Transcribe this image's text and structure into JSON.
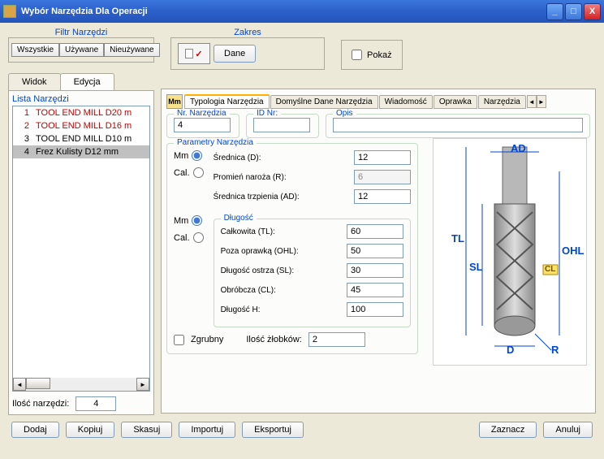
{
  "window": {
    "title": "Wybór Narzędzia Dla Operacji"
  },
  "filter": {
    "label": "Filtr Narzędzi",
    "all": "Wszystkie",
    "used": "Używane",
    "unused": "Nieużywane"
  },
  "zakres": {
    "label": "Zakres",
    "dane": "Dane",
    "pokaz": "Pokaż"
  },
  "tabs": {
    "widok": "Widok",
    "edycja": "Edycja"
  },
  "listLabel": "Lista  Narzędzi",
  "tools": [
    {
      "n": "1",
      "name": "TOOL END MILL  D20 m",
      "red": true
    },
    {
      "n": "2",
      "name": "TOOL END MILL  D16 m",
      "red": true
    },
    {
      "n": "3",
      "name": "TOOL END MILL  D10 m",
      "red": false
    },
    {
      "n": "4",
      "name": "Frez Kulisty  D12 mm",
      "red": false,
      "sel": true
    }
  ],
  "iloscLabel": "Ilość narzędzi:",
  "iloscVal": "4",
  "smallTabs": {
    "typologia": "Typologia Narzędzia",
    "domyslne": "Domyślne Dane Narzędzia",
    "wiadomosc": "Wiadomość",
    "oprawka": "Oprawka",
    "narzedzia": "Narzędzia"
  },
  "fields": {
    "nrLabel": "Nr. Narzędzia",
    "nrVal": "4",
    "idLabel": "ID Nr:",
    "idVal": "",
    "opisLabel": "Opis",
    "opisVal": ""
  },
  "params": {
    "title": "Parametry Narzędzia",
    "mm": "Mm",
    "cal": "Cal.",
    "srednica": "Średnica (D):",
    "srednicaVal": "12",
    "promien": "Promień naroża (R):",
    "promienVal": "6",
    "trzpien": "Średnica trzpienia (AD):",
    "trzpienVal": "12"
  },
  "dlugosc": {
    "title": "Długość",
    "calkowita": "Całkowita (TL):",
    "calkowitaVal": "60",
    "poza": "Poza oprawką (OHL):",
    "pozaVal": "50",
    "ostrza": "Długość ostrza (SL):",
    "ostrzaVal": "30",
    "obrobcza": "Obróbcza (CL):",
    "obrobczaVal": "45",
    "h": "Długość H:",
    "hVal": "100"
  },
  "zgrubny": "Zgrubny",
  "zlobki": "Ilość żłobków:",
  "zlobkiVal": "2",
  "diagram": {
    "ad": "AD",
    "tl": "TL",
    "sl": "SL",
    "ohl": "OHL",
    "cl": "CL",
    "d": "D",
    "r": "R"
  },
  "buttons": {
    "dodaj": "Dodaj",
    "kopiuj": "Kopiuj",
    "skasuj": "Skasuj",
    "importuj": "Importuj",
    "eksportuj": "Eksportuj",
    "zaznacz": "Zaznacz",
    "anuluj": "Anuluj"
  }
}
